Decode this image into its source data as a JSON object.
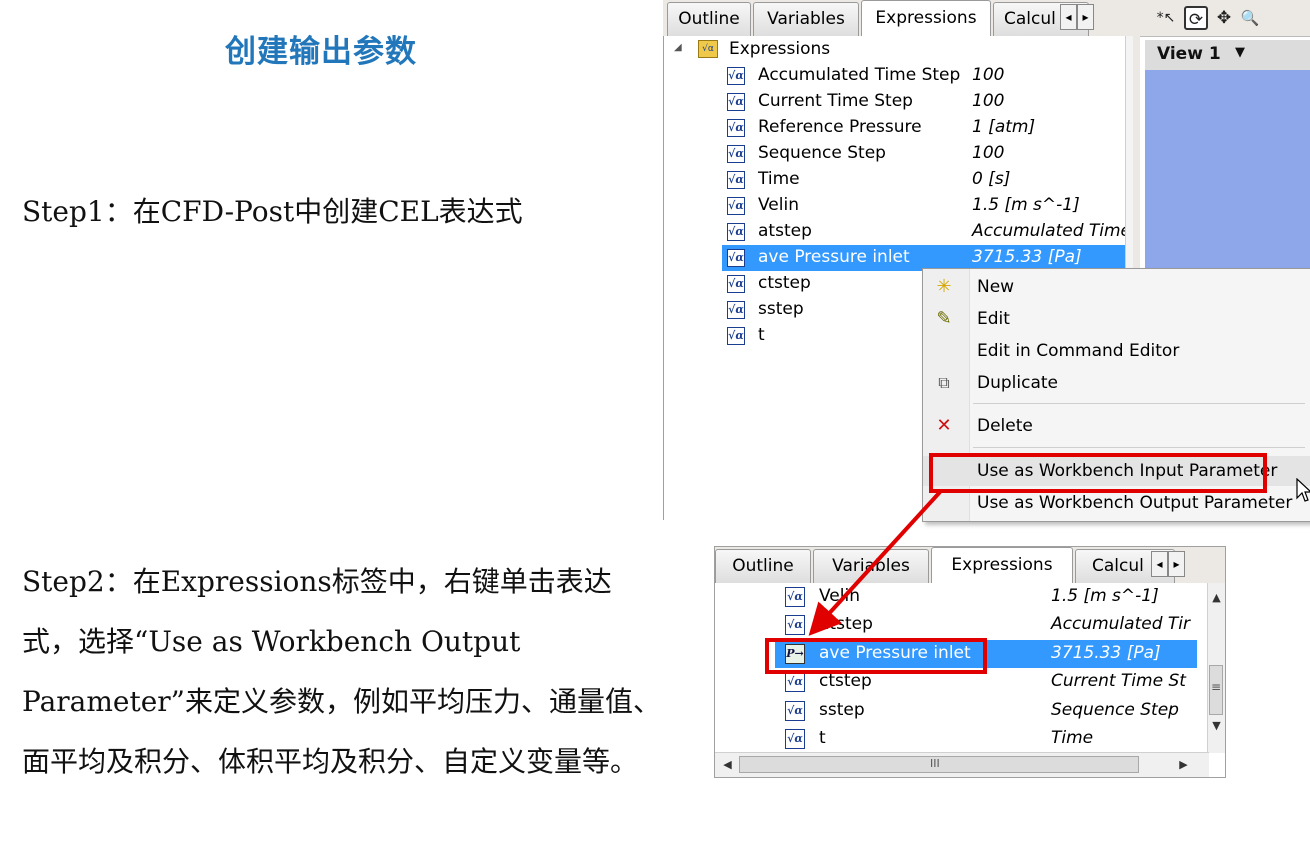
{
  "slide": {
    "title": "创建输出参数",
    "step1": "Step1：在CFD-Post中创建CEL表达式",
    "step2": "Step2：在Expressions标签中，右键单击表达式，选择“Use as Workbench Output Parameter”来定义参数，例如平均压力、通量值、面平均及积分、体积平均及积分、自定义变量等。"
  },
  "tabs": [
    "Outline",
    "Variables",
    "Expressions",
    "Calcul"
  ],
  "tab_nav": {
    "left": "◂",
    "right": "▸"
  },
  "tree": {
    "root": "Expressions",
    "expand_glyph": "◢",
    "icon_glyph": "√α",
    "items": [
      {
        "name": "Accumulated Time Step",
        "value": "100"
      },
      {
        "name": "Current Time Step",
        "value": "100"
      },
      {
        "name": "Reference Pressure",
        "value": "1 [atm]"
      },
      {
        "name": "Sequence Step",
        "value": "100"
      },
      {
        "name": "Time",
        "value": "0 [s]"
      },
      {
        "name": "Velin",
        "value": "1.5 [m s^-1]"
      },
      {
        "name": "atstep",
        "value": "Accumulated Time"
      },
      {
        "name": "ave Pressure inlet",
        "value": "3715.33 [Pa]"
      },
      {
        "name": "ctstep",
        "value": ""
      },
      {
        "name": "sstep",
        "value": ""
      },
      {
        "name": "t",
        "value": ""
      }
    ]
  },
  "viewer": {
    "view_label": "View 1",
    "dropdown": "▼",
    "toolbar_icons": [
      "*↖",
      "⟳",
      "✥",
      "🔍"
    ]
  },
  "context_menu": {
    "items": [
      {
        "label": "New",
        "icon": "✳"
      },
      {
        "label": "Edit",
        "icon": "✎"
      },
      {
        "label": "Edit in Command Editor",
        "icon": ""
      },
      {
        "label": "Duplicate",
        "icon": "⧉"
      },
      {
        "label": "Delete",
        "icon": "✕"
      },
      {
        "label": "Use as Workbench Input Parameter",
        "icon": ""
      },
      {
        "label": "Use as Workbench Output Parameter",
        "icon": ""
      }
    ]
  },
  "lower_list": {
    "items": [
      {
        "name": "Velin",
        "value": "1.5 [m s^-1]"
      },
      {
        "name": "atstep",
        "value": "Accumulated Tir"
      },
      {
        "name": "ave Pressure inlet",
        "value": "3715.33 [Pa]"
      },
      {
        "name": "ctstep",
        "value": "Current Time St"
      },
      {
        "name": "sstep",
        "value": "Sequence Step"
      },
      {
        "name": "t",
        "value": "Time"
      }
    ],
    "param_icon_glyph": "P→",
    "hscroll_grip": "III",
    "vscroll_grip": "≡",
    "arrows": {
      "up": "▲",
      "down": "▼",
      "left": "◀",
      "right": "▶"
    }
  },
  "colors": {
    "title": "#2277bb",
    "selection": "#3399ff",
    "highlight": "#e00000",
    "viewer_bg": "#8ea6ea"
  }
}
